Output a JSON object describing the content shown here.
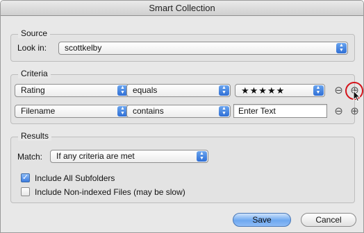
{
  "window": {
    "title": "Smart Collection"
  },
  "source": {
    "legend": "Source",
    "look_in_label": "Look in:",
    "look_in_value": "scottkelby"
  },
  "criteria": {
    "legend": "Criteria",
    "rows": [
      {
        "field": "Rating",
        "operator": "equals",
        "value": "★★★★★",
        "value_kind": "popup"
      },
      {
        "field": "Filename",
        "operator": "contains",
        "value": "Enter Text",
        "value_kind": "textfield"
      }
    ],
    "remove_symbol": "⊖",
    "add_symbol": "⊕"
  },
  "results": {
    "legend": "Results",
    "match_label": "Match:",
    "match_value": "If any criteria are met",
    "include_subfolders_label": "Include All Subfolders",
    "include_subfolders_checked": true,
    "include_nonindexed_label": "Include Non-indexed Files (may be slow)",
    "include_nonindexed_checked": false
  },
  "buttons": {
    "save": "Save",
    "cancel": "Cancel"
  },
  "colors": {
    "accent": "#3d7de0",
    "highlight_ring": "#d4141b"
  },
  "icons": {
    "popup_arrows": "updown-arrows-icon",
    "remove": "minus-circle-icon",
    "add": "plus-circle-icon",
    "checkmark": "checkmark-icon",
    "cursor": "mouse-pointer-icon"
  }
}
